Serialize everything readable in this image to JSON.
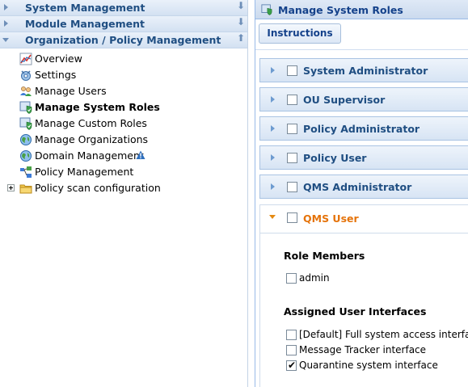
{
  "nav": {
    "sections": [
      {
        "label": "System Management",
        "expanded": false
      },
      {
        "label": "Module Management",
        "expanded": false
      },
      {
        "label": "Organization / Policy Management",
        "expanded": true
      }
    ],
    "items": [
      {
        "label": "Overview",
        "icon": "chart-icon"
      },
      {
        "label": "Settings",
        "icon": "settings-icon"
      },
      {
        "label": "Manage Users",
        "icon": "users-icon"
      },
      {
        "label": "Manage System Roles",
        "icon": "shield-icon",
        "selected": true
      },
      {
        "label": "Manage Custom Roles",
        "icon": "shield-icon"
      },
      {
        "label": "Manage Organizations",
        "icon": "globe-icon"
      },
      {
        "label": "Domain Management",
        "icon": "globe-icon",
        "warning": true
      },
      {
        "label": "Policy Management",
        "icon": "policy-icon"
      },
      {
        "label": "Policy scan configuration",
        "icon": "folder-icon"
      }
    ]
  },
  "panel": {
    "title": "Manage System Roles",
    "instructions_label": "Instructions",
    "roles": [
      {
        "label": "System Administrator",
        "checked": false,
        "expanded": false
      },
      {
        "label": "OU Supervisor",
        "checked": false,
        "expanded": false
      },
      {
        "label": "Policy Administrator",
        "checked": false,
        "expanded": false
      },
      {
        "label": "Policy User",
        "checked": false,
        "expanded": false
      },
      {
        "label": "QMS Administrator",
        "checked": false,
        "expanded": false
      },
      {
        "label": "QMS User",
        "checked": false,
        "expanded": true
      }
    ],
    "role_members": {
      "heading": "Role Members",
      "items": [
        {
          "label": "admin",
          "checked": false
        }
      ]
    },
    "assigned_interfaces": {
      "heading": "Assigned User Interfaces",
      "items": [
        {
          "label": "[Default] Full system access interface",
          "checked": false
        },
        {
          "label": "Message Tracker interface",
          "checked": false
        },
        {
          "label": "Quarantine system interface",
          "checked": true
        }
      ]
    }
  },
  "colors": {
    "accent": "#1f4e82",
    "expanded_role": "#e5730a",
    "header_bg": "#d3e1f2"
  }
}
